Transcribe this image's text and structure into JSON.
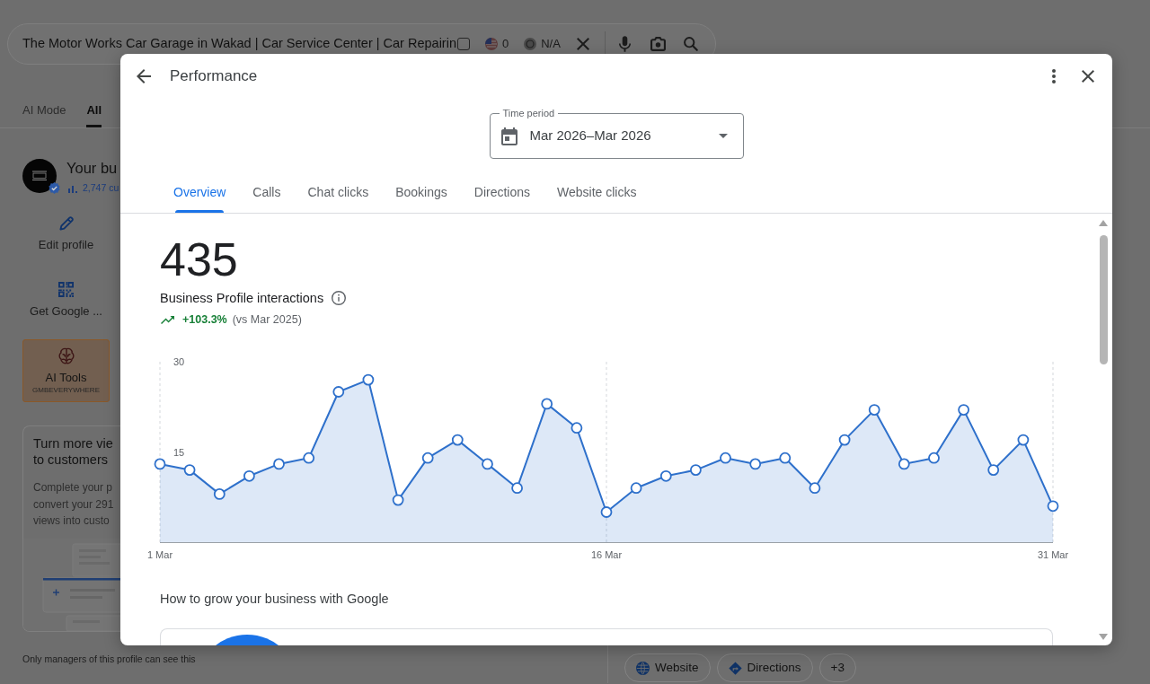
{
  "search_bar": {
    "query": "The Motor Works Car Garage in Wakad | Car Service Center | Car Repairin",
    "checked": false,
    "extensions": [
      {
        "kind": "flag",
        "text": "0"
      },
      {
        "kind": "coin",
        "text": "N/A"
      }
    ]
  },
  "search_tabs": [
    {
      "label": "AI Mode",
      "selected": false
    },
    {
      "label": "All",
      "selected": true
    }
  ],
  "business_panel": {
    "name": "Your bu",
    "stat": "2,747 cu",
    "actions": [
      {
        "kind": "edit",
        "label": "Edit profile"
      },
      {
        "kind": "qr",
        "label": "Get Google ..."
      }
    ],
    "ai_tools": {
      "title": "AI Tools",
      "subtitle": "GMBEVERYWHERE"
    },
    "promo_card": {
      "title_lines": [
        "Turn more vie",
        "to customers"
      ],
      "body_lines": [
        "Complete your p",
        "convert your 291",
        "views into custo"
      ]
    }
  },
  "footer_note": "Only managers of this profile can see this",
  "action_chips": [
    {
      "kind": "website",
      "label": "Website"
    },
    {
      "kind": "directions",
      "label": "Directions"
    },
    {
      "kind": "more",
      "label": "+3"
    }
  ],
  "dialog": {
    "title": "Performance",
    "time_period": {
      "label": "Time period",
      "value": "Mar 2026–Mar 2026"
    },
    "tabs": [
      {
        "label": "Overview",
        "selected": true
      },
      {
        "label": "Calls",
        "selected": false
      },
      {
        "label": "Chat clicks",
        "selected": false
      },
      {
        "label": "Bookings",
        "selected": false
      },
      {
        "label": "Directions",
        "selected": false
      },
      {
        "label": "Website clicks",
        "selected": false
      }
    ],
    "metric": {
      "value": "435",
      "label": "Business Profile interactions",
      "change": "+103.3%",
      "comparison": "(vs Mar 2025)"
    },
    "chart_data": {
      "type": "area",
      "categories": [
        "1 Mar",
        null,
        null,
        null,
        null,
        null,
        null,
        null,
        null,
        null,
        null,
        null,
        null,
        null,
        null,
        "16 Mar",
        null,
        null,
        null,
        null,
        null,
        null,
        null,
        null,
        null,
        null,
        null,
        null,
        null,
        null,
        "31 Mar"
      ],
      "series": [
        {
          "color": "#2e70cb",
          "values": [
            13,
            12,
            8,
            11,
            13,
            14,
            25,
            27,
            7,
            14,
            17,
            13,
            9,
            23,
            19,
            5,
            9,
            11,
            12,
            14,
            13,
            14,
            9,
            17,
            22,
            13,
            14,
            22,
            12,
            17,
            6
          ]
        }
      ],
      "ylim": [
        0,
        30
      ],
      "yticks": [
        15,
        30
      ]
    },
    "section_title": "How to grow your business with Google"
  }
}
